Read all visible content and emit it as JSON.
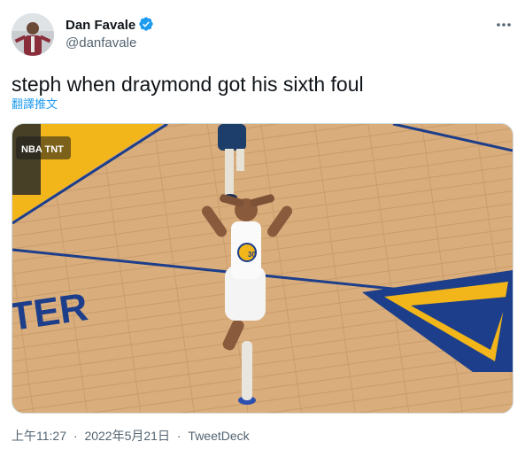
{
  "tweet": {
    "author": {
      "display_name": "Dan Favale",
      "handle": "@danfavale",
      "verified": true
    },
    "text": "steph when draymond got his sixth foul",
    "translate_label": "翻譯推文",
    "media": {
      "broadcast_logo": "NBA TNT",
      "jersey_number": "30",
      "court_lettering": "TER"
    },
    "footer": {
      "time": "上午11:27",
      "date": "2022年5月21日",
      "source": "TweetDeck",
      "separator": "·"
    }
  },
  "colors": {
    "verified_blue": "#1d9bf0",
    "link_blue": "#1d9bf0",
    "secondary_text": "#536471",
    "court_wood": "#d7ac7b",
    "court_navy": "#1d3e8a",
    "court_gold": "#f2b61a"
  },
  "icons": {
    "verified": "verified-badge-icon",
    "more": "more-options-icon"
  }
}
